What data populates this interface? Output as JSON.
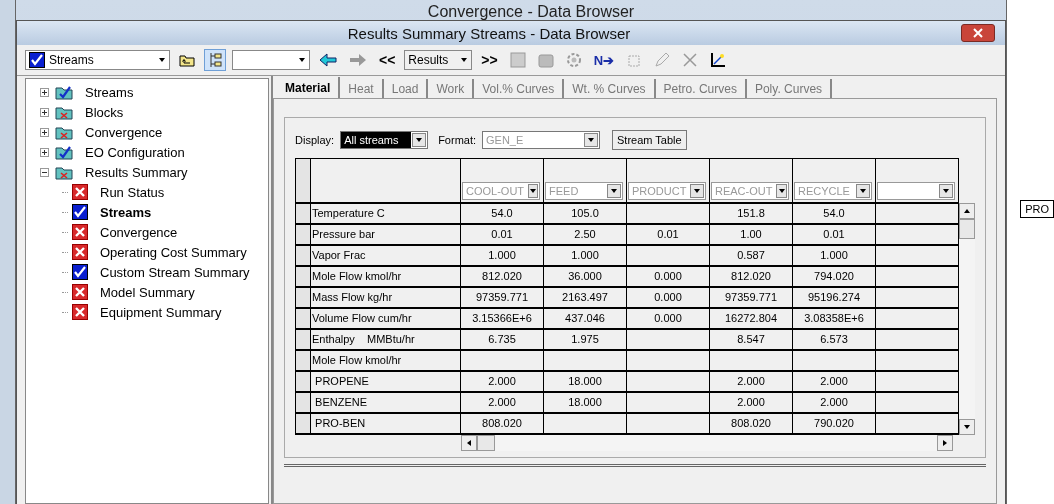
{
  "back_window": {
    "title": "Convergence - Data Browser"
  },
  "window": {
    "title": "Results Summary Streams - Data Browser"
  },
  "toolbar": {
    "object_select": {
      "value": "Streams",
      "complete": true
    },
    "nav_prev": "<<",
    "section_select": {
      "value": "Results"
    },
    "nav_next": ">>",
    "next_input": "N➔",
    "back_enabled": true,
    "forward_enabled": false
  },
  "tree": [
    {
      "label": "Streams",
      "complete": true,
      "expanded": false,
      "selected": false
    },
    {
      "label": "Blocks",
      "complete": false,
      "expanded": false,
      "selected": false
    },
    {
      "label": "Convergence",
      "complete": false,
      "expanded": false,
      "selected": false
    },
    {
      "label": "EO Configuration",
      "complete": true,
      "expanded": false,
      "selected": false
    },
    {
      "label": "Results Summary",
      "complete": false,
      "expanded": true,
      "selected": false,
      "children": [
        {
          "label": "Run Status",
          "complete": false,
          "selected": false
        },
        {
          "label": "Streams",
          "complete": true,
          "selected": true
        },
        {
          "label": "Convergence",
          "complete": false,
          "selected": false
        },
        {
          "label": "Operating Cost Summary",
          "complete": false,
          "selected": false
        },
        {
          "label": "Custom Stream Summary",
          "complete": true,
          "selected": false
        },
        {
          "label": "Model Summary",
          "complete": false,
          "selected": false
        },
        {
          "label": "Equipment Summary",
          "complete": false,
          "selected": false
        }
      ]
    }
  ],
  "tabs": [
    {
      "label": "Material",
      "selected": true
    },
    {
      "label": "Heat",
      "selected": false
    },
    {
      "label": "Load",
      "selected": false
    },
    {
      "label": "Work",
      "selected": false
    },
    {
      "label": "Vol.% Curves",
      "selected": false
    },
    {
      "label": "Wt. % Curves",
      "selected": false
    },
    {
      "label": "Petro. Curves",
      "selected": false
    },
    {
      "label": "Poly. Curves",
      "selected": false
    }
  ],
  "display": {
    "label": "Display:",
    "value": "All streams"
  },
  "format": {
    "label": "Format:",
    "value": "GEN_E",
    "disabled": true
  },
  "stream_table_button": "Stream Table",
  "table": {
    "columns": [
      "COOL-OUT",
      "FEED",
      "PRODUCT",
      "REAC-OUT",
      "RECYCLE"
    ],
    "rows": [
      {
        "label": "Temperature C",
        "cells": {
          "column_1": "54.0",
          "column_2": "105.0",
          "column_4": "151.8",
          "column_5": "54.0"
        }
      },
      {
        "label": "Pressure bar",
        "cells": {
          "column_1": "0.01",
          "column_2": "2.50",
          "column_3": "0.01",
          "column_4": "1.00",
          "column_5": "0.01"
        }
      },
      {
        "label": "Vapor Frac",
        "cells": {
          "column_1": "1.000",
          "column_2": "1.000",
          "column_4": "0.587",
          "column_5": "1.000"
        }
      },
      {
        "label": "Mole Flow kmol/hr",
        "cells": {
          "column_1": "812.020",
          "column_2": "36.000",
          "column_3": "0.000",
          "column_4": "812.020",
          "column_5": "794.020"
        }
      },
      {
        "label": "Mass Flow kg/hr",
        "cells": {
          "column_1": "97359.771",
          "column_2": "2163.497",
          "column_3": "0.000",
          "column_4": "97359.771",
          "column_5": "95196.274"
        }
      },
      {
        "label": "Volume Flow cum/hr",
        "cells": {
          "column_1": "3.15366E+6",
          "column_2": "437.046",
          "column_3": "0.000",
          "column_4": "16272.804",
          "column_5": "3.08358E+6"
        }
      },
      {
        "label": "Enthalpy    MMBtu/hr",
        "cells": {
          "column_1": "6.735",
          "column_2": "1.975",
          "column_4": "8.547",
          "column_5": "6.573"
        }
      },
      {
        "label": "Mole Flow kmol/hr"
      },
      {
        "label": " PROPENE",
        "cells": {
          "column_1": "2.000",
          "column_2": "18.000",
          "column_4": "2.000",
          "column_5": "2.000"
        }
      },
      {
        "label": " BENZENE",
        "cells": {
          "column_1": "2.000",
          "column_2": "18.000",
          "column_4": "2.000",
          "column_5": "2.000"
        }
      },
      {
        "label": " PRO-BEN",
        "cells": {
          "column_1": "808.020",
          "column_4": "808.020",
          "column_5": "790.020"
        }
      }
    ]
  },
  "canvas": {
    "block_label": "PRO"
  }
}
